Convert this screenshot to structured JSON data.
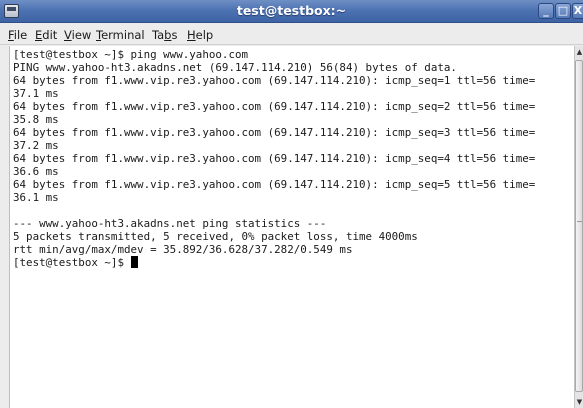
{
  "window": {
    "title": "test@testbox:~",
    "controls": {
      "minimize_glyph": "_",
      "maximize_glyph": "□",
      "close_glyph": "X"
    }
  },
  "menubar": {
    "items": [
      {
        "prefix": "",
        "mnemonic": "F",
        "rest": "ile"
      },
      {
        "prefix": "",
        "mnemonic": "E",
        "rest": "dit"
      },
      {
        "prefix": "",
        "mnemonic": "V",
        "rest": "iew"
      },
      {
        "prefix": "",
        "mnemonic": "T",
        "rest": "erminal"
      },
      {
        "prefix": "Ta",
        "mnemonic": "b",
        "rest": "s"
      },
      {
        "prefix": "",
        "mnemonic": "H",
        "rest": "elp"
      }
    ]
  },
  "terminal": {
    "lines": [
      "[test@testbox ~]$ ping www.yahoo.com",
      "PING www.yahoo-ht3.akadns.net (69.147.114.210) 56(84) bytes of data.",
      "64 bytes from f1.www.vip.re3.yahoo.com (69.147.114.210): icmp_seq=1 ttl=56 time=",
      "37.1 ms",
      "64 bytes from f1.www.vip.re3.yahoo.com (69.147.114.210): icmp_seq=2 ttl=56 time=",
      "35.8 ms",
      "64 bytes from f1.www.vip.re3.yahoo.com (69.147.114.210): icmp_seq=3 ttl=56 time=",
      "37.2 ms",
      "64 bytes from f1.www.vip.re3.yahoo.com (69.147.114.210): icmp_seq=4 ttl=56 time=",
      "36.6 ms",
      "64 bytes from f1.www.vip.re3.yahoo.com (69.147.114.210): icmp_seq=5 ttl=56 time=",
      "36.1 ms",
      "",
      "--- www.yahoo-ht3.akadns.net ping statistics ---",
      "5 packets transmitted, 5 received, 0% packet loss, time 4000ms",
      "rtt min/avg/max/mdev = 35.892/36.628/37.282/0.549 ms"
    ],
    "prompt": "[test@testbox ~]$ "
  },
  "scrollbar": {
    "up_glyph": "▲",
    "down_glyph": "▼"
  }
}
